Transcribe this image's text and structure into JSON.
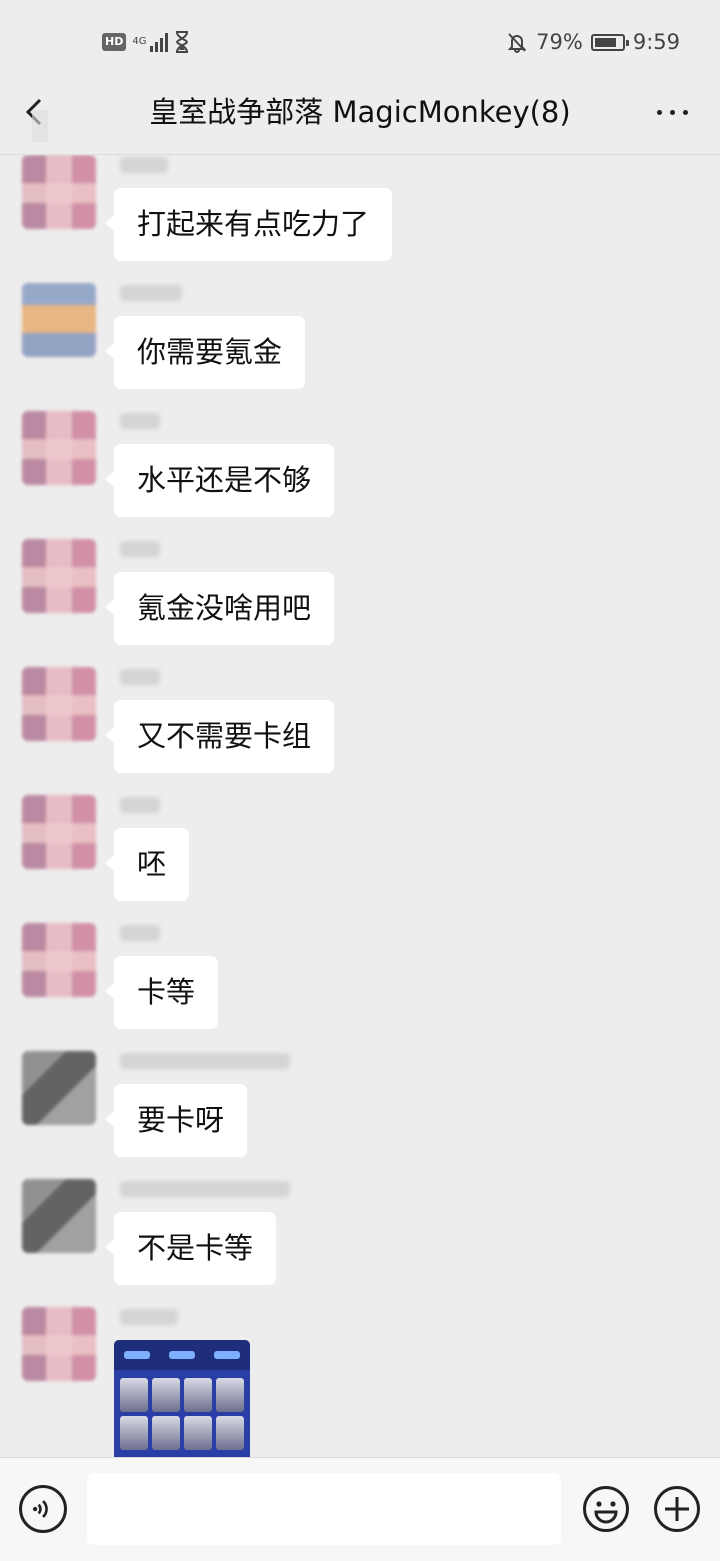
{
  "status_bar": {
    "hd": "HD",
    "network": "4G",
    "battery_percent": "79%",
    "battery_level": 0.79,
    "time": "9:59"
  },
  "header": {
    "title": "皇室战争部落 MagicMonkey(8)",
    "back_icon": "back-arrow-icon",
    "more_icon": "more-dots-icon"
  },
  "messages": [
    {
      "text": "打起来有点吃力了",
      "avatar": "pink"
    },
    {
      "text": "你需要氪金",
      "avatar": "blue"
    },
    {
      "text": "水平还是不够",
      "avatar": "pink"
    },
    {
      "text": "氪金没啥用吧",
      "avatar": "pink"
    },
    {
      "text": "又不需要卡组",
      "avatar": "pink"
    },
    {
      "text": "呸",
      "avatar": "pink"
    },
    {
      "text": "卡等",
      "avatar": "pink"
    },
    {
      "text": "要卡呀",
      "avatar": "gray"
    },
    {
      "text": "不是卡等",
      "avatar": "gray"
    }
  ],
  "image_message": {
    "kind": "game-screenshot"
  },
  "input_bar": {
    "voice_icon": "voice-icon",
    "emoji_icon": "emoji-icon",
    "plus_icon": "plus-icon"
  }
}
